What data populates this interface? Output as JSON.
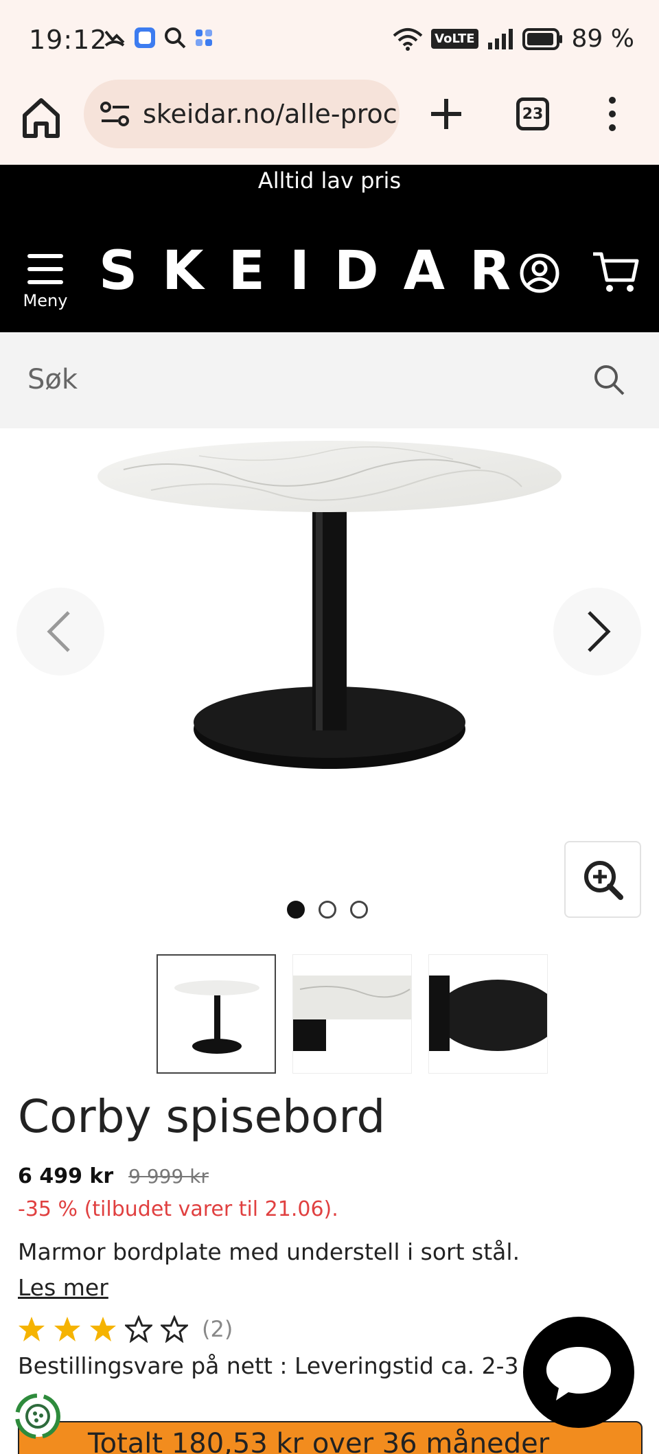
{
  "status_bar": {
    "time": "19:12",
    "volte_label": "VoLTE",
    "battery_percent": "89 %"
  },
  "browser": {
    "url": "skeidar.no/alle-proc",
    "tab_count": "23"
  },
  "header": {
    "promo": "Alltid lav pris",
    "menu_label": "Meny",
    "logo": "SKEIDAR"
  },
  "search": {
    "placeholder": "Søk"
  },
  "gallery": {
    "slide_count": 3,
    "active_slide": 1,
    "thumbnail_count": 3
  },
  "product": {
    "title": "Corby spisebord",
    "price": "6 499 kr",
    "old_price": "9 999 kr",
    "discount": "-35 % (tilbudet varer til 21.06).",
    "description": "Marmor bordplate med understell i sort stål.",
    "read_more": "Les mer",
    "rating_stars": 3,
    "rating_max": 5,
    "review_count": "(2)",
    "delivery": "Bestillingsvare på nett : Leveringstid ca. 2-3"
  },
  "finance": {
    "label": "Totalt 180,53 kr over 36 måneder"
  },
  "colors": {
    "header_bg": "#000000",
    "discount": "#e04040",
    "star": "#f5b301",
    "finance_bg": "#f28c1e",
    "browser_bg": "#fdf3ef"
  }
}
